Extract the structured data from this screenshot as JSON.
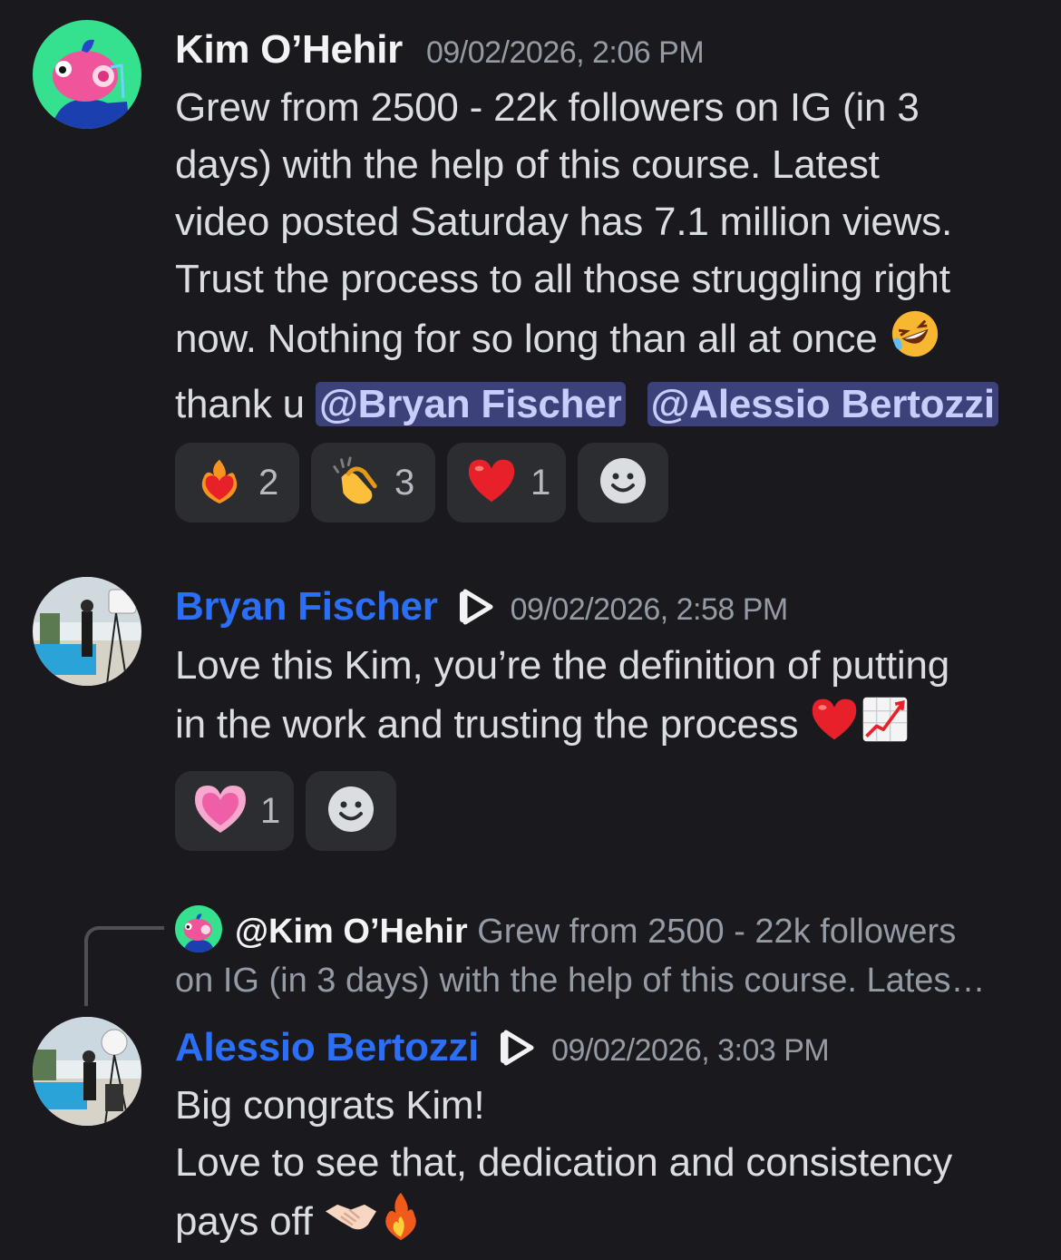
{
  "messages": [
    {
      "author": "Kim O’Hehir",
      "timestamp": "09/02/2026, 2:06 PM",
      "lines": [
        "Grew from 2500 - 22k followers on IG (in 3",
        "days) with the help of this course. Latest",
        "video posted Saturday has 7.1 million views.",
        "Trust the process to all those struggling right",
        "now. Nothing for so long than all at once"
      ],
      "last_line_prefix": "thank u ",
      "mentions": [
        "@Bryan Fischer",
        "@Alessio Bertozzi"
      ],
      "reactions": [
        {
          "emoji": "heart-on-fire",
          "count": "2"
        },
        {
          "emoji": "clapping-hands",
          "count": "3"
        },
        {
          "emoji": "red-heart",
          "count": "1"
        }
      ]
    },
    {
      "author": "Bryan Fischer",
      "timestamp": "09/02/2026, 2:58 PM",
      "lines": [
        "Love this Kim, you’re the definition of putting",
        "in the work and trusting the process"
      ],
      "reactions": [
        {
          "emoji": "growing-heart",
          "count": "1"
        }
      ]
    },
    {
      "reply_to": {
        "author": "@Kim O’Hehir",
        "preview_line1": "Grew from 2500 - 22k followers",
        "preview_line2": "on IG (in 3 days) with the help of this course. Lates…"
      },
      "author": "Alessio Bertozzi",
      "timestamp": "09/02/2026, 3:03 PM",
      "lines": [
        "Big congrats Kim!",
        "Love to see that, dedication and consistency",
        "pays off"
      ]
    }
  ],
  "colors": {
    "background": "#1a1a1e",
    "author_blue": "#2b6ef7",
    "mention_bg": "#3c4279",
    "reaction_bg": "#2b2d31"
  }
}
